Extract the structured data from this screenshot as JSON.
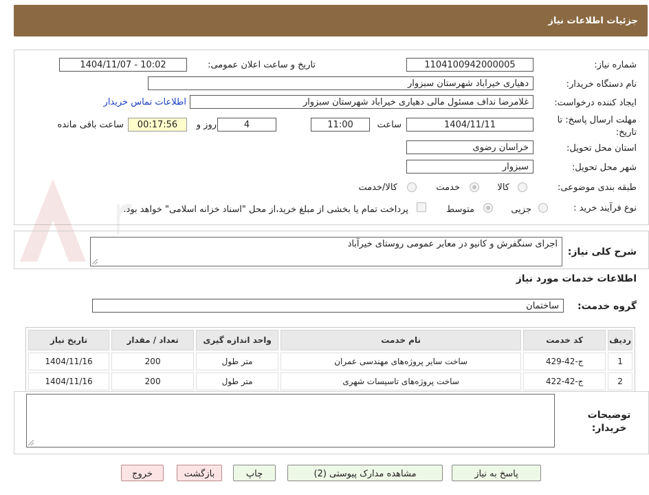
{
  "header": {
    "title": "جزئیات اطلاعات نیاز"
  },
  "form": {
    "need_number_label": "شماره نیاز:",
    "need_number": "1104100942000005",
    "announce_label": "تاریخ و ساعت اعلان عمومی:",
    "announce_value": "1404/11/07 - 10:02",
    "buyer_org_label": "نام دستگاه خریدار:",
    "buyer_org": "دهیاری خیراباد شهرستان سبزوار",
    "requester_label": "ایجاد کننده درخواست:",
    "requester": "غلامرضا نداف مسئول مالی دهیاری خیراباد شهرستان سبزوار",
    "contact_link": "اطلاعات تماس خریدار",
    "deadline_label": "مهلت ارسال پاسخ: تا تاریخ:",
    "deadline_date": "1404/11/11",
    "time_label": "ساعت",
    "deadline_time": "11:00",
    "days_value": "4",
    "days_label": "روز و",
    "remaining_time": "00:17:56",
    "remaining_label": "ساعت باقی مانده",
    "province_label": "استان محل تحویل:",
    "province": "خراسان رضوی",
    "city_label": "شهر محل تحویل:",
    "city": "سبزوار",
    "category_label": "طبقه بندی موضوعی:",
    "category_options": [
      "کالا",
      "خدمت",
      "کالا/خدمت"
    ],
    "category_selected": "خدمت",
    "process_label": "نوع فرآیند خرید :",
    "process_options": [
      "جزیی",
      "متوسط"
    ],
    "process_selected": "متوسط",
    "payment_note": "پرداخت تمام یا بخشی از مبلغ خرید،از محل \"اسناد خزانه اسلامی\" خواهد بود."
  },
  "description": {
    "label": "شرح کلی نیاز:",
    "text": "اجرای سنگفرش و کانیو در معابر عمومی روستای خیرآباد"
  },
  "services": {
    "section_title": "اطلاعات خدمات مورد نیاز",
    "group_label": "گروه خدمت:",
    "group_value": "ساختمان",
    "columns": [
      "ردیف",
      "کد خدمت",
      "نام خدمت",
      "واحد اندازه گیری",
      "تعداد / مقدار",
      "تاریخ نیاز"
    ],
    "rows": [
      [
        "1",
        "ج-42-429",
        "ساخت سایر پروژه‌های مهندسی عمران",
        "متر طول",
        "200",
        "1404/11/16"
      ],
      [
        "2",
        "ج-42-422",
        "ساخت پروژه‌های تاسیسات شهری",
        "متر طول",
        "200",
        "1404/11/16"
      ]
    ]
  },
  "notes": {
    "label": "توضیحات خریدار:"
  },
  "buttons": {
    "reply": "پاسخ به نیاز",
    "attachments": "مشاهده مدارک پیوستی (2)",
    "print": "چاپ",
    "back": "بازگشت",
    "exit": "خروج"
  },
  "colors": {
    "header": "#8b6a43",
    "green_button": "#eef8e6",
    "red_button": "#fde4e4",
    "timer": "#ffffcc"
  }
}
